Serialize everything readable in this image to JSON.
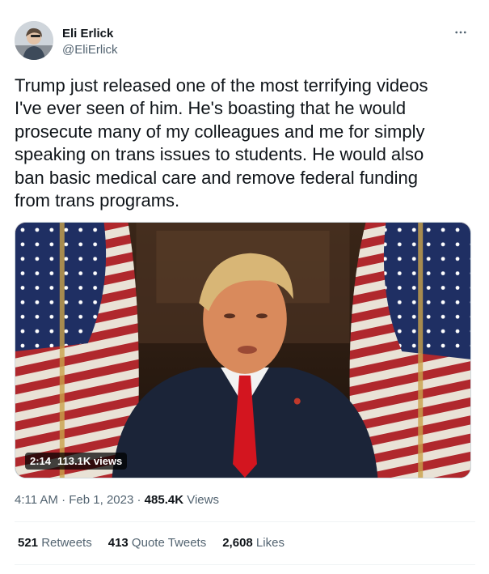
{
  "author": {
    "name": "Eli Erlick",
    "handle": "@EliErlick"
  },
  "tweet": {
    "text": "Trump just released one of the most terrifying videos\nI've ever seen of him. He's boasting that he would\nprosecute many of my colleagues and me for simply\nspeaking on trans issues to students. He would also\nban basic medical care and remove federal funding\nfrom trans programs."
  },
  "video": {
    "duration": "2:14",
    "views": "113.1K views"
  },
  "meta": {
    "time": "4:11 AM",
    "sep1": " · ",
    "date": "Feb 1, 2023",
    "sep2": " · ",
    "view_count": "485.4K",
    "view_label": " Views"
  },
  "stats": {
    "retweets_count": "521",
    "retweets_label": " Retweets",
    "quotes_count": "413",
    "quotes_label": " Quote Tweets",
    "likes_count": "2,608",
    "likes_label": " Likes"
  },
  "icons": {
    "more": "more-horizontal-icon"
  },
  "colors": {
    "text_primary": "#0f1419",
    "text_secondary": "#536471",
    "divider": "#eff3f4"
  }
}
